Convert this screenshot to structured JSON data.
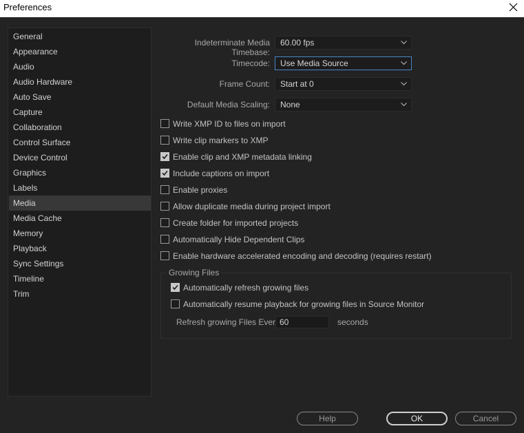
{
  "window": {
    "title": "Preferences"
  },
  "sidebar": {
    "items": [
      {
        "label": "General"
      },
      {
        "label": "Appearance"
      },
      {
        "label": "Audio"
      },
      {
        "label": "Audio Hardware"
      },
      {
        "label": "Auto Save"
      },
      {
        "label": "Capture"
      },
      {
        "label": "Collaboration"
      },
      {
        "label": "Control Surface"
      },
      {
        "label": "Device Control"
      },
      {
        "label": "Graphics"
      },
      {
        "label": "Labels"
      },
      {
        "label": "Media"
      },
      {
        "label": "Media Cache"
      },
      {
        "label": "Memory"
      },
      {
        "label": "Playback"
      },
      {
        "label": "Sync Settings"
      },
      {
        "label": "Timeline"
      },
      {
        "label": "Trim"
      }
    ],
    "selected": "Media"
  },
  "fields": {
    "timebase": {
      "label": "Indeterminate Media Timebase:",
      "value": "60.00 fps"
    },
    "timecode": {
      "label": "Timecode:",
      "value": "Use Media Source"
    },
    "frame_count": {
      "label": "Frame Count:",
      "value": "Start at 0"
    },
    "scaling": {
      "label": "Default Media Scaling:",
      "value": "None"
    }
  },
  "checkboxes": [
    {
      "label": "Write XMP ID to files on import",
      "checked": false
    },
    {
      "label": "Write clip markers to XMP",
      "checked": false
    },
    {
      "label": "Enable clip and XMP metadata linking",
      "checked": true
    },
    {
      "label": "Include captions on import",
      "checked": true
    },
    {
      "label": "Enable proxies",
      "checked": false
    },
    {
      "label": "Allow duplicate media during project import",
      "checked": false
    },
    {
      "label": "Create folder for imported projects",
      "checked": false
    },
    {
      "label": "Automatically Hide Dependent Clips",
      "checked": false
    },
    {
      "label": "Enable hardware accelerated encoding and decoding (requires restart)",
      "checked": false
    }
  ],
  "growing_files": {
    "title": "Growing Files",
    "auto_refresh": {
      "label": "Automatically refresh growing files",
      "checked": true
    },
    "auto_resume": {
      "label": "Automatically resume playback for growing files in Source Monitor",
      "checked": false
    },
    "refresh_every": {
      "label": "Refresh growing Files Every",
      "value": "60",
      "unit": "seconds"
    }
  },
  "buttons": {
    "help": "Help",
    "ok": "OK",
    "cancel": "Cancel"
  },
  "colors": {
    "accent": "#4a86c8",
    "panel": "#232323",
    "sidebar": "#1d1d1d",
    "selected": "#383838"
  }
}
